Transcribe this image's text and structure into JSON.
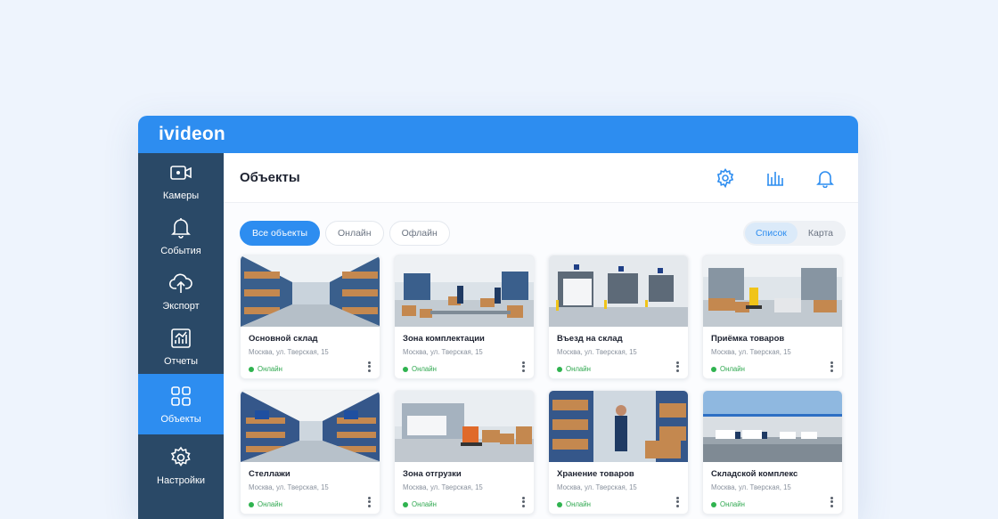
{
  "app": {
    "logo": "ivideon"
  },
  "sidebar": {
    "items": [
      {
        "label": "Камеры",
        "icon": "camera-icon"
      },
      {
        "label": "События",
        "icon": "bell-icon"
      },
      {
        "label": "Экспорт",
        "icon": "cloud-upload-icon"
      },
      {
        "label": "Отчеты",
        "icon": "chart-icon"
      },
      {
        "label": "Объекты",
        "icon": "objects-icon",
        "active": true
      },
      {
        "label": "Настройки",
        "icon": "gear-icon"
      }
    ]
  },
  "header": {
    "title": "Объекты",
    "icons": [
      "gear-icon",
      "signal-bars-icon",
      "bell-icon"
    ]
  },
  "filters": {
    "chips": [
      {
        "label": "Все объекты",
        "active": true
      },
      {
        "label": "Онлайн",
        "active": false
      },
      {
        "label": "Офлайн",
        "active": false
      }
    ],
    "view": [
      {
        "label": "Список",
        "active": true
      },
      {
        "label": "Карта",
        "active": false
      }
    ]
  },
  "objects": [
    {
      "title": "Основной склад",
      "address": "Москва, ул. Тверская, 15",
      "status": "Онлайн"
    },
    {
      "title": "Зона комплектации",
      "address": "Москва, ул. Тверская, 15",
      "status": "Онлайн"
    },
    {
      "title": "Въезд на склад",
      "address": "Москва, ул. Тверская, 15",
      "status": "Онлайн"
    },
    {
      "title": "Приёмка товаров",
      "address": "Москва, ул. Тверская, 15",
      "status": "Онлайн"
    },
    {
      "title": "Стеллажи",
      "address": "Москва, ул. Тверская, 15",
      "status": "Онлайн"
    },
    {
      "title": "Зона отгрузки",
      "address": "Москва, ул. Тверская, 15",
      "status": "Онлайн"
    },
    {
      "title": "Хранение товаров",
      "address": "Москва, ул. Тверская, 15",
      "status": "Онлайн"
    },
    {
      "title": "Складской комплекс",
      "address": "Москва, ул. Тверская, 15",
      "status": "Онлайн"
    }
  ],
  "colors": {
    "accent": "#2d8df0",
    "sidebar": "#2a4967",
    "online": "#2fb34f"
  }
}
